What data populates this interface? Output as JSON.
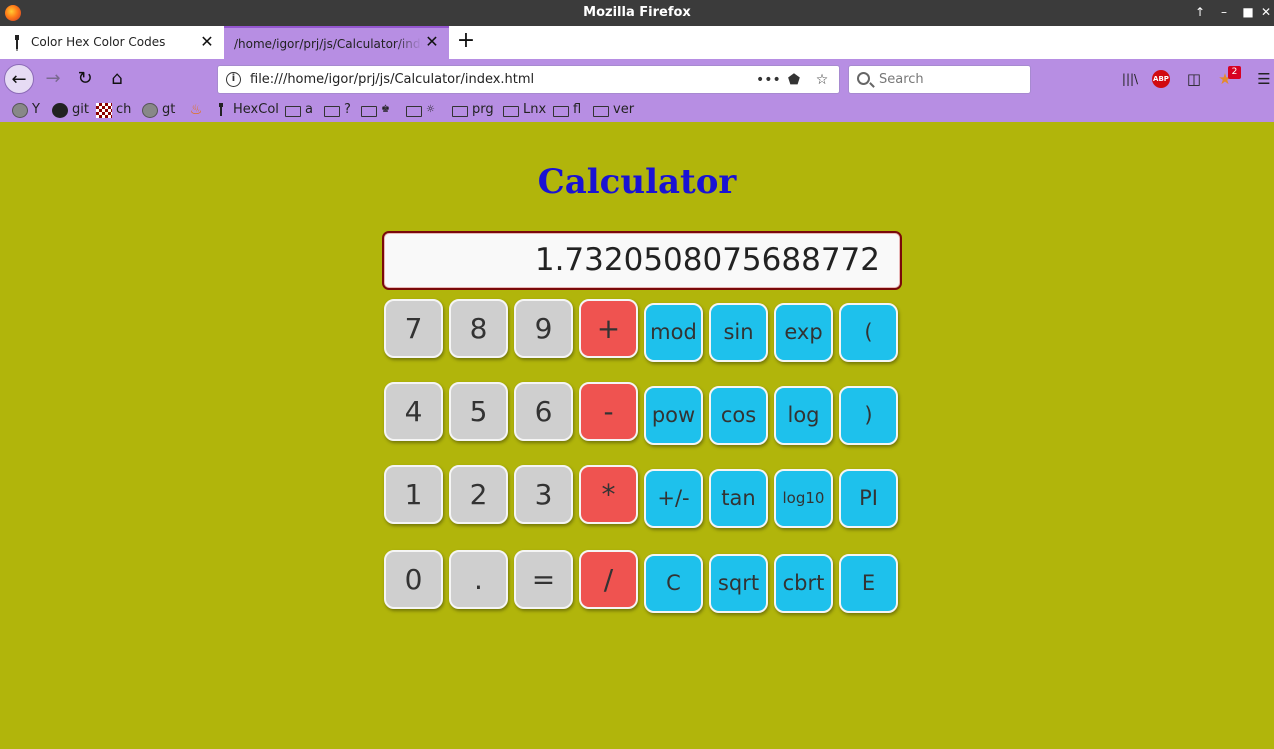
{
  "window": {
    "title": "Mozilla Firefox",
    "controls": [
      "↑",
      "–",
      "■",
      "✕"
    ]
  },
  "tabs": [
    {
      "label": "Color Hex Color Codes",
      "close": "✕"
    },
    {
      "label": "/home/igor/prj/js/Calculator/index.html",
      "close": "✕"
    }
  ],
  "new_tab": "+",
  "nav": {
    "back": "←",
    "forward": "→",
    "reload": "↻",
    "home": "⌂",
    "info": "i",
    "url": "file:///home/igor/prj/js/Calculator/index.html",
    "page_actions": "•••",
    "pocket": "⬟",
    "star": "☆",
    "search_placeholder": "Search",
    "library": "|||\\",
    "abp": "ABP",
    "sidebar": "◫",
    "extension": "★",
    "extension_badge": "2",
    "menu": "☰"
  },
  "bookmarks": [
    {
      "label": "Y",
      "icon": "globe-icon"
    },
    {
      "label": "git",
      "icon": "github-icon"
    },
    {
      "label": "ch",
      "icon": "checker-icon"
    },
    {
      "label": "gt",
      "icon": "globe-icon"
    },
    {
      "label": "",
      "icon": "java-icon"
    },
    {
      "label": "HexCol",
      "icon": "dropper-icon"
    },
    {
      "label": "a",
      "icon": "folder-icon"
    },
    {
      "label": "?",
      "icon": "folder-icon"
    },
    {
      "label": "♚",
      "icon": "folder-icon"
    },
    {
      "label": "☼",
      "icon": "folder-icon"
    },
    {
      "label": "prg",
      "icon": "folder-icon"
    },
    {
      "label": "Lnx",
      "icon": "folder-icon"
    },
    {
      "label": "fl",
      "icon": "folder-icon"
    },
    {
      "label": "ver",
      "icon": "folder-icon"
    }
  ],
  "page": {
    "title": "Calculator",
    "display": "1.7320508075688772"
  },
  "keys": [
    [
      "7",
      "8",
      "9",
      "+",
      "mod",
      "sin",
      "exp",
      "("
    ],
    [
      "4",
      "5",
      "6",
      "-",
      "pow",
      "cos",
      "log",
      ")"
    ],
    [
      "1",
      "2",
      "3",
      "*",
      "+/-",
      "tan",
      "log10",
      "PI"
    ],
    [
      "0",
      ".",
      "=",
      "/",
      "C",
      "sqrt",
      "cbrt",
      "E"
    ]
  ],
  "colors": {
    "page_bg": "#b1b50b",
    "title": "#1a12d4",
    "number_key": "#cfcfcf",
    "operator_key": "#ef5350",
    "function_key": "#1ec1ec",
    "toolbar": "#b78ee3"
  }
}
